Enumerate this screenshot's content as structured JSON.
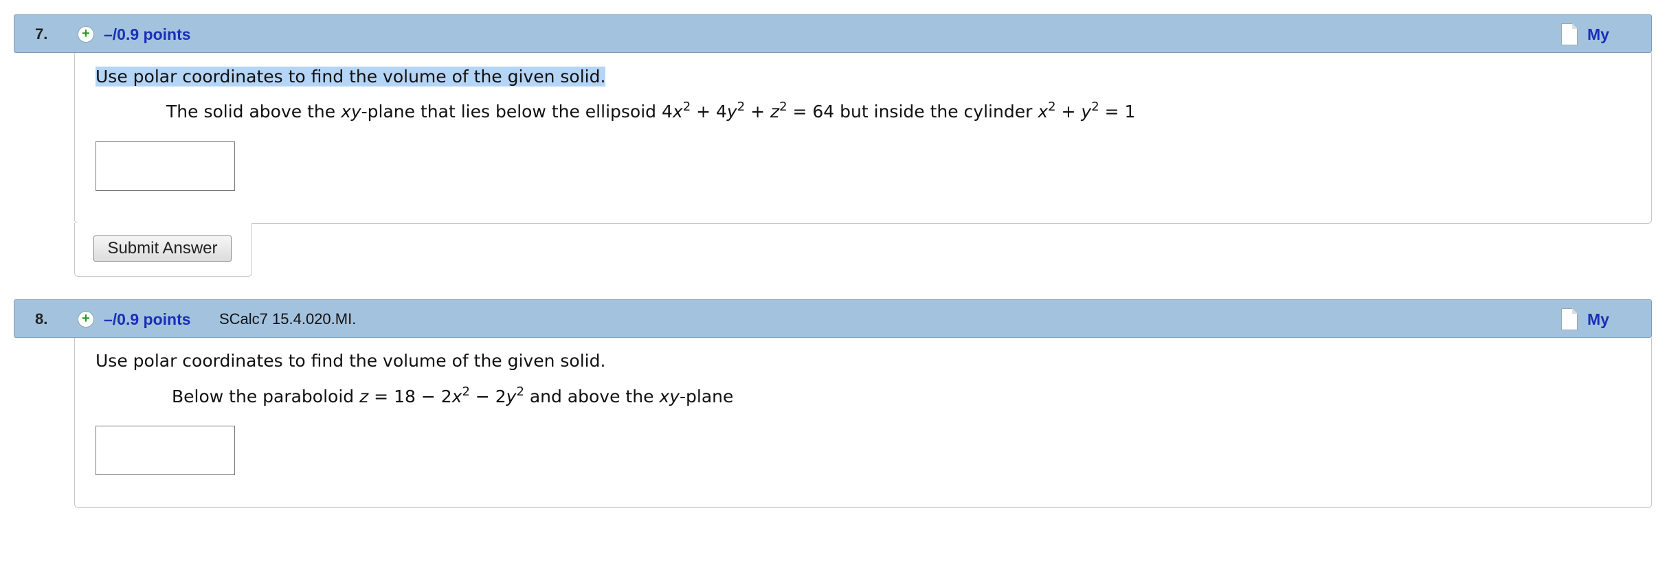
{
  "questions": [
    {
      "number": "7.",
      "points": "–/0.9 points",
      "reference": "",
      "notes_label": "My Notes",
      "prompt": "Use polar coordinates to find the volume of the given solid.",
      "problem_parts": {
        "t1": "The solid above the ",
        "xy": "xy",
        "t2": "-plane that lies below the ellipsoid  4",
        "x": "x",
        "two": "2",
        "plus4": " + 4",
        "y": "y",
        "plus": " + ",
        "z": "z",
        "eq64": " = 64  but inside the cylinder  ",
        "eq1": " = 1"
      },
      "answer_value": "",
      "submit_label": "Submit Answer"
    },
    {
      "number": "8.",
      "points": "–/0.9 points",
      "reference": "SCalc7 15.4.020.MI.",
      "notes_label": "My Notes",
      "prompt": "Use polar coordinates to find the volume of the given solid.",
      "problem_parts": {
        "t1": "Below the paraboloid ",
        "z": "z",
        "t2": " = 18 − 2",
        "x": "x",
        "two": "2",
        "minus2": " − 2",
        "y": "y",
        "t3": " and above the ",
        "xy": "xy",
        "t4": "-plane"
      },
      "answer_value": ""
    }
  ],
  "colors": {
    "header_bg": "#a3c2dd",
    "link": "#1a2fb8",
    "selection_highlight": "#b5d5f7"
  },
  "icons": {
    "expand": "plus-circle-icon",
    "notes": "document-icon"
  }
}
